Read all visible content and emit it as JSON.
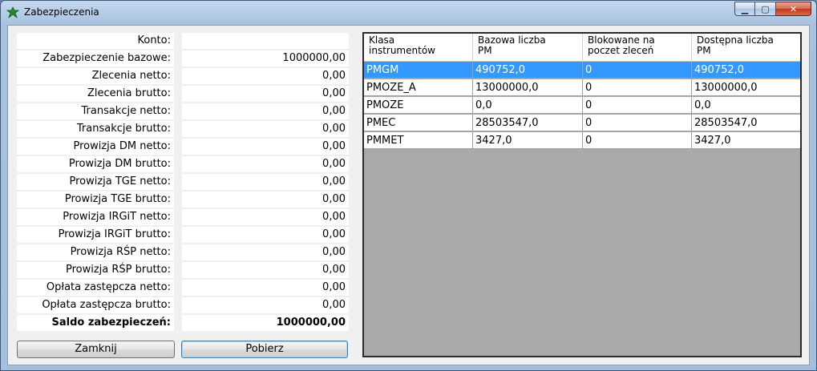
{
  "window": {
    "title": "Zabezpieczenia"
  },
  "form": {
    "rows": [
      {
        "label": "Konto:",
        "value": ""
      },
      {
        "label": "Zabezpieczenie bazowe:",
        "value": "1000000,00"
      },
      {
        "label": "Zlecenia netto:",
        "value": "0,00"
      },
      {
        "label": "Zlecenia brutto:",
        "value": "0,00"
      },
      {
        "label": "Transakcje netto:",
        "value": "0,00"
      },
      {
        "label": "Transakcje brutto:",
        "value": "0,00"
      },
      {
        "label": "Prowizja DM netto:",
        "value": "0,00"
      },
      {
        "label": "Prowizja DM brutto:",
        "value": "0,00"
      },
      {
        "label": "Prowizja TGE netto:",
        "value": "0,00"
      },
      {
        "label": "Prowizja TGE brutto:",
        "value": "0,00"
      },
      {
        "label": "Prowizja IRGiT netto:",
        "value": "0,00"
      },
      {
        "label": "Prowizja IRGiT brutto:",
        "value": "0,00"
      },
      {
        "label": "Prowizja RŚP netto:",
        "value": "0,00"
      },
      {
        "label": "Prowizja RŚP brutto:",
        "value": "0,00"
      },
      {
        "label": "Opłata zastępcza netto:",
        "value": "0,00"
      },
      {
        "label": "Opłata zastępcza brutto:",
        "value": "0,00"
      },
      {
        "label": "Saldo zabezpieczeń:",
        "value": "1000000,00"
      }
    ]
  },
  "buttons": {
    "close_label": "Zamknij",
    "fetch_label": "Pobierz"
  },
  "table": {
    "headers": [
      [
        "Klasa",
        "instrumentów"
      ],
      [
        "Bazowa liczba",
        "PM"
      ],
      [
        "Blokowane na",
        "poczet zleceń"
      ],
      [
        "Dostępna liczba",
        "PM"
      ]
    ],
    "rows": [
      [
        "PMGM",
        "490752,0",
        "0",
        "490752,0"
      ],
      [
        "PMOZE_A",
        "13000000,0",
        "0",
        "13000000,0"
      ],
      [
        "PMOZE",
        "0,0",
        "0",
        "0,0"
      ],
      [
        "PMEC",
        "28503547,0",
        "0",
        "28503547,0"
      ],
      [
        "PMMET",
        "3427,0",
        "0",
        "3427,0"
      ]
    ],
    "selected_row": 0
  },
  "colors": {
    "selection": "#3399ff",
    "grid_background": "#a9a9a9"
  }
}
